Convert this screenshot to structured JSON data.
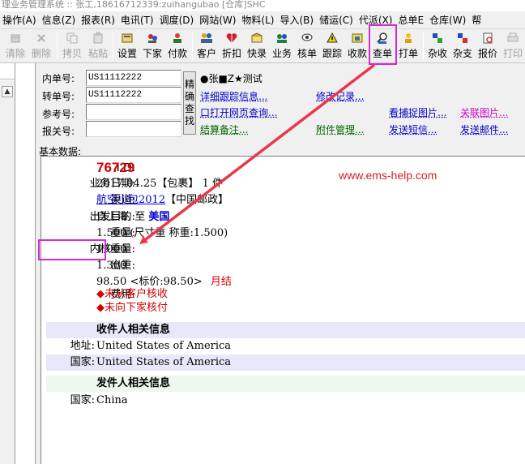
{
  "titlebar": {
    "text": "理业务管理系统 :: 张工,18616712339:zuihangubao [仓库]SHC"
  },
  "menubar": {
    "items": [
      "操作(A)",
      "信息(Z)",
      "报表(R)",
      "电讯(T)",
      "调度(D)",
      "网站(W)",
      "物料(L)",
      "导入(B)",
      "储运(C)",
      "代派(X)",
      "总单E",
      "仓库(W)",
      "帮"
    ]
  },
  "toolbar": {
    "buttons": [
      {
        "label": "清除",
        "icon": "clear-icon",
        "enabled": false
      },
      {
        "label": "删除",
        "icon": "delete-icon",
        "enabled": false
      },
      {
        "label": "拷贝",
        "icon": "copy-icon",
        "enabled": false
      },
      {
        "label": "粘贴",
        "icon": "paste-icon",
        "enabled": false
      },
      {
        "label": "设置",
        "icon": "settings-icon",
        "enabled": true
      },
      {
        "label": "下家",
        "icon": "downstream-icon",
        "enabled": true
      },
      {
        "label": "付款",
        "icon": "payment-icon",
        "enabled": true
      },
      {
        "label": "客户",
        "icon": "customer-icon",
        "enabled": true
      },
      {
        "label": "折扣",
        "icon": "discount-icon",
        "enabled": true
      },
      {
        "label": "快录",
        "icon": "quick-entry-icon",
        "enabled": true
      },
      {
        "label": "业务",
        "icon": "business-icon",
        "enabled": true
      },
      {
        "label": "核单",
        "icon": "verify-icon",
        "enabled": true
      },
      {
        "label": "跟踪",
        "icon": "tracking-icon",
        "enabled": true
      },
      {
        "label": "收款",
        "icon": "collect-icon",
        "enabled": true
      },
      {
        "label": "查单",
        "icon": "lookup-icon",
        "enabled": true
      },
      {
        "label": "打单",
        "icon": "print-label-icon",
        "enabled": true
      },
      {
        "label": "杂收",
        "icon": "misc-income-icon",
        "enabled": true
      },
      {
        "label": "杂支",
        "icon": "misc-expense-icon",
        "enabled": true
      },
      {
        "label": "报价",
        "icon": "quote-icon",
        "enabled": true
      },
      {
        "label": "打印",
        "icon": "print-icon",
        "enabled": false
      }
    ]
  },
  "form": {
    "neidan_label": "内单号:",
    "neidan_value": "US11112222",
    "zhuandan_label": "转单号:",
    "zhuandan_value": "US11112222",
    "cankao_label": "参考号:",
    "cankao_value": "",
    "baoguan_label": "报关号:",
    "baoguan_value": "",
    "search_button": [
      "精",
      "确",
      "查",
      "找"
    ],
    "customer_text": "●张■Z★测试",
    "links": {
      "detail_track": "详细跟踪信息...",
      "modify_record": "修改记录...",
      "open_web_query": "口打开网页查询...",
      "capture_image": "看捕捉图片...",
      "related_image": "关联图片...",
      "settlement_note": "结算备注...",
      "attachment_mgmt": "附件管理...",
      "send_sms": "发送短信...",
      "send_email": "发送邮件..."
    }
  },
  "basic": {
    "header": "基本数据:",
    "id_label": "I D:",
    "id_value": "76729",
    "date_label": "业务日期:",
    "date_value": "2017.04.25【包裹】 1 件",
    "channel_label": "渠道:",
    "channel_link": "航空小包2012",
    "channel_rest": "【中国邮政】",
    "dest_label": "出发目的:",
    "dest_prefix": "自上海. 至",
    "dest_country": "美国",
    "weight_label": "重量:",
    "weight_value": "1.500 (尺寸重 称重:1.500)",
    "core_weight_label": "内核重量:",
    "core_weight_value": "1.000",
    "out_weight_label": "出重:",
    "out_weight_value": "1.300",
    "fee_label": "费用:",
    "fee_amount": "98.50 <标价:98.50>",
    "fee_term": "月结",
    "fee_note1": "◆未从客户核收",
    "fee_note2": "◆未向下家核付",
    "receiver_header": "收件人相关信息",
    "address_label": "地址:",
    "address_value": "United States of America",
    "country_label": "国家:",
    "country_value": "United States of America",
    "sender_header": "发件人相关信息",
    "sender_country_label": "国家:",
    "sender_country_value": "China"
  },
  "watermark": "www.ems-help.com",
  "colors": {
    "id_red": "#d40000",
    "highlight_magenta": "#d12bd1",
    "arrow_red": "#e8384a",
    "link_blue": "#0000cc"
  }
}
